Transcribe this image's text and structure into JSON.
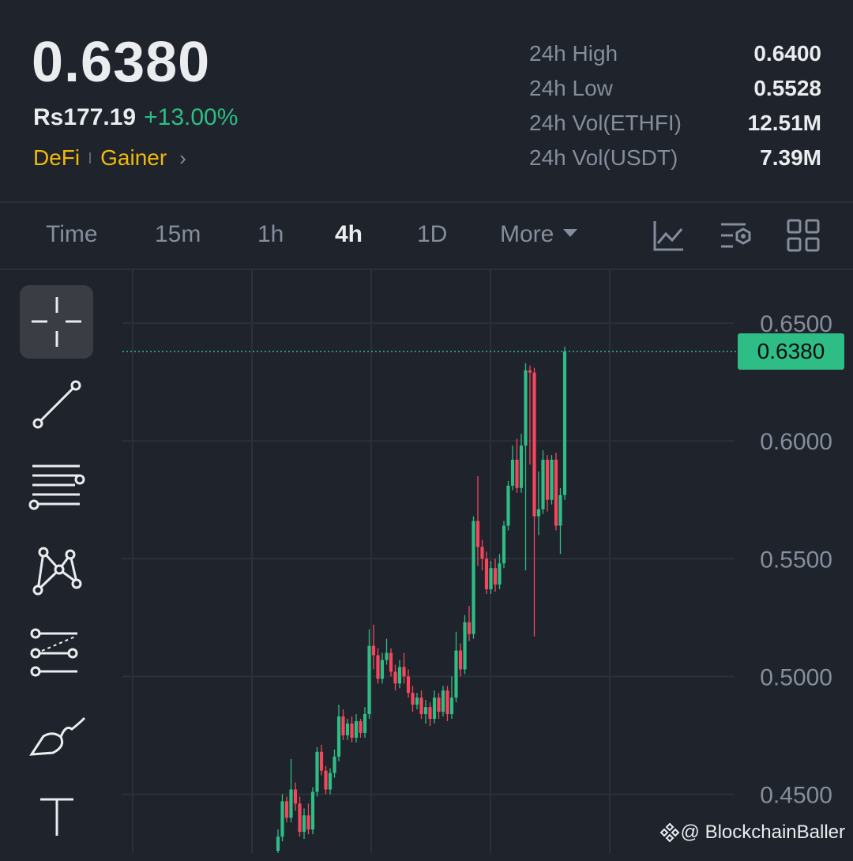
{
  "ticker": {
    "last_price": "0.6380",
    "fiat_price": "Rs177.19",
    "change_pct": "+13.00%",
    "tags": [
      "DeFi",
      "Gainer"
    ]
  },
  "stats": [
    {
      "label": "24h High",
      "value": "0.6400"
    },
    {
      "label": "24h Low",
      "value": "0.5528"
    },
    {
      "label": "24h Vol(ETHFI)",
      "value": "12.51M"
    },
    {
      "label": "24h Vol(USDT)",
      "value": "7.39M"
    }
  ],
  "intervals": {
    "time": "Time",
    "m15": "15m",
    "h1": "1h",
    "h4": "4h",
    "d1": "1D",
    "more": "More",
    "active": "4h"
  },
  "tool_icons": [
    "chart-indicator-icon",
    "chart-settings-icon",
    "layout-grid-icon"
  ],
  "side_tools": [
    "crosshair-icon",
    "trend-line-icon",
    "horizontal-lines-icon",
    "pattern-icon",
    "fib-tool-icon",
    "brush-icon",
    "text-tool-icon"
  ],
  "chart_data": {
    "type": "candlestick",
    "y_ticks": [
      "0.6500",
      "0.6000",
      "0.5500",
      "0.5000",
      "0.4500"
    ],
    "ylim": [
      0.425,
      0.6725
    ],
    "last_price_label": "0.6380",
    "last_price": 0.638,
    "colors": {
      "up": "#2ebd85",
      "down": "#f6465d",
      "grid": "#2b3139"
    },
    "candles": [
      [
        0.426,
        0.432,
        0.422,
        0.435
      ],
      [
        0.432,
        0.447,
        0.43,
        0.45
      ],
      [
        0.447,
        0.44,
        0.438,
        0.449
      ],
      [
        0.44,
        0.452,
        0.438,
        0.465
      ],
      [
        0.452,
        0.446,
        0.443,
        0.455
      ],
      [
        0.446,
        0.434,
        0.432,
        0.449
      ],
      [
        0.434,
        0.441,
        0.431,
        0.444
      ],
      [
        0.441,
        0.435,
        0.433,
        0.446
      ],
      [
        0.435,
        0.451,
        0.433,
        0.453
      ],
      [
        0.451,
        0.468,
        0.449,
        0.47
      ],
      [
        0.468,
        0.46,
        0.458,
        0.471
      ],
      [
        0.46,
        0.452,
        0.45,
        0.462
      ],
      [
        0.452,
        0.459,
        0.45,
        0.461
      ],
      [
        0.459,
        0.466,
        0.457,
        0.469
      ],
      [
        0.466,
        0.483,
        0.464,
        0.488
      ],
      [
        0.483,
        0.475,
        0.473,
        0.486
      ],
      [
        0.475,
        0.48,
        0.473,
        0.482
      ],
      [
        0.48,
        0.474,
        0.472,
        0.483
      ],
      [
        0.474,
        0.481,
        0.472,
        0.484
      ],
      [
        0.481,
        0.476,
        0.474,
        0.482
      ],
      [
        0.476,
        0.484,
        0.474,
        0.487
      ],
      [
        0.484,
        0.513,
        0.482,
        0.52
      ],
      [
        0.513,
        0.509,
        0.503,
        0.522
      ],
      [
        0.509,
        0.499,
        0.497,
        0.512
      ],
      [
        0.499,
        0.507,
        0.497,
        0.51
      ],
      [
        0.507,
        0.51,
        0.505,
        0.516
      ],
      [
        0.51,
        0.502,
        0.5,
        0.512
      ],
      [
        0.502,
        0.497,
        0.494,
        0.505
      ],
      [
        0.497,
        0.504,
        0.495,
        0.507
      ],
      [
        0.504,
        0.5,
        0.497,
        0.51
      ],
      [
        0.5,
        0.493,
        0.491,
        0.503
      ],
      [
        0.493,
        0.488,
        0.485,
        0.496
      ],
      [
        0.488,
        0.491,
        0.486,
        0.493
      ],
      [
        0.491,
        0.484,
        0.482,
        0.494
      ],
      [
        0.484,
        0.487,
        0.48,
        0.49
      ],
      [
        0.487,
        0.482,
        0.479,
        0.489
      ],
      [
        0.482,
        0.491,
        0.48,
        0.494
      ],
      [
        0.491,
        0.485,
        0.482,
        0.493
      ],
      [
        0.485,
        0.494,
        0.483,
        0.496
      ],
      [
        0.494,
        0.484,
        0.481,
        0.496
      ],
      [
        0.484,
        0.491,
        0.482,
        0.5
      ],
      [
        0.491,
        0.511,
        0.489,
        0.519
      ],
      [
        0.511,
        0.503,
        0.5,
        0.514
      ],
      [
        0.503,
        0.523,
        0.501,
        0.526
      ],
      [
        0.523,
        0.518,
        0.515,
        0.53
      ],
      [
        0.518,
        0.566,
        0.516,
        0.568
      ],
      [
        0.566,
        0.555,
        0.547,
        0.585
      ],
      [
        0.555,
        0.55,
        0.545,
        0.558
      ],
      [
        0.55,
        0.537,
        0.535,
        0.553
      ],
      [
        0.537,
        0.546,
        0.535,
        0.549
      ],
      [
        0.546,
        0.539,
        0.536,
        0.55
      ],
      [
        0.539,
        0.548,
        0.537,
        0.552
      ],
      [
        0.548,
        0.564,
        0.546,
        0.566
      ],
      [
        0.564,
        0.581,
        0.562,
        0.583
      ],
      [
        0.581,
        0.592,
        0.579,
        0.598
      ],
      [
        0.592,
        0.58,
        0.578,
        0.601
      ],
      [
        0.58,
        0.598,
        0.578,
        0.603
      ],
      [
        0.598,
        0.63,
        0.545,
        0.633
      ],
      [
        0.63,
        0.629,
        0.59,
        0.632
      ],
      [
        0.629,
        0.568,
        0.517,
        0.631
      ],
      [
        0.568,
        0.571,
        0.56,
        0.587
      ],
      [
        0.571,
        0.592,
        0.569,
        0.596
      ],
      [
        0.592,
        0.575,
        0.57,
        0.594
      ],
      [
        0.575,
        0.592,
        0.573,
        0.594
      ],
      [
        0.592,
        0.564,
        0.562,
        0.595
      ],
      [
        0.564,
        0.577,
        0.552,
        0.58
      ],
      [
        0.577,
        0.638,
        0.575,
        0.64
      ]
    ]
  },
  "watermark": "@ BlockchainBaller"
}
